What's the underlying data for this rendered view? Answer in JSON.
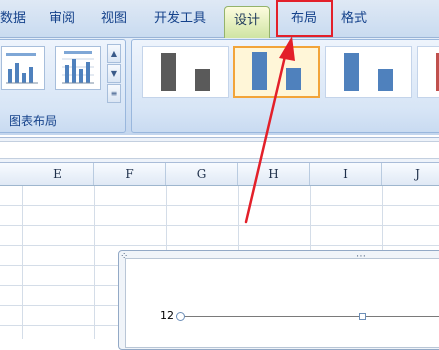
{
  "ribbon": {
    "tabs": [
      {
        "label": "数据",
        "selected": false
      },
      {
        "label": "审阅",
        "selected": false
      },
      {
        "label": "视图",
        "selected": false
      },
      {
        "label": "开发工具",
        "selected": false
      },
      {
        "label": "设计",
        "selected": true
      },
      {
        "label": "布局",
        "selected": false,
        "highlighted": true
      },
      {
        "label": "格式",
        "selected": false
      }
    ],
    "layout_group_label": "图表布局",
    "gallery_scroll_icons": [
      "scroll-up-icon",
      "scroll-down-icon",
      "more-icon"
    ],
    "chart_styles_selected_index": 1
  },
  "sheet": {
    "columns": [
      "E",
      "F",
      "G",
      "H",
      "I",
      "J"
    ]
  },
  "chart": {
    "y_tick_label": "12"
  },
  "colors": {
    "annotation_red": "#e3202a",
    "style_dark_gray": "#5a5a5a",
    "style_blue": "#4f81bd",
    "selection_orange": "#f2a43a"
  }
}
